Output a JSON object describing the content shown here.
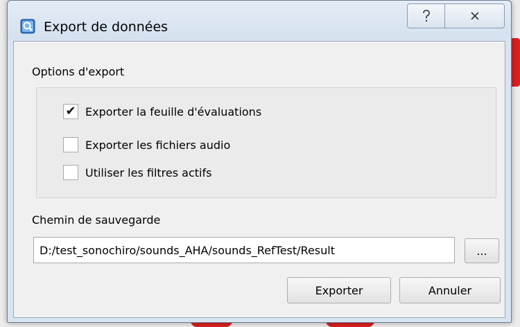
{
  "window": {
    "title": "Export de données",
    "help_glyph": "?",
    "close_glyph": "✕"
  },
  "options": {
    "group_label": "Options d'export",
    "items": [
      {
        "label": "Exporter la feuille d'évaluations",
        "checked": true,
        "mark": "✔"
      },
      {
        "label": "Exporter les fichiers audio",
        "checked": false,
        "mark": ""
      },
      {
        "label": "Utiliser les filtres actifs",
        "checked": false,
        "mark": ""
      }
    ]
  },
  "save_path": {
    "label": "Chemin de sauvegarde",
    "value": "D:/test_sonochiro/sounds_AHA/sounds_RefTest/Result",
    "browse_label": "..."
  },
  "buttons": {
    "export_label": "Exporter",
    "cancel_label": "Annuler"
  },
  "colors": {
    "titlebar": "#d9e4f1",
    "client": "#f0f0f0"
  }
}
